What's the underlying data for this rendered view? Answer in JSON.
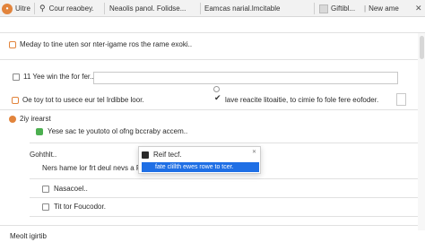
{
  "tabs": [
    {
      "label": "Uitre"
    },
    {
      "label": "Cour reaobey."
    },
    {
      "label": "Neaolis panol. Folidse..."
    },
    {
      "label": "Eamcas narial.lmcitable"
    },
    {
      "label": "Giftibl..."
    },
    {
      "label": "New ame"
    }
  ],
  "rows": {
    "r1": "Meday to tine uten sor nter-igame ros the rame exoki..",
    "r2_label": "11 Yee win the for fer..",
    "r3": "Oe toy tot to usece eur tel Irdibbe loor.",
    "r3_right": "lave reacite litoaitie, to cimie fo fole fere eofoder.",
    "section_title": "2iy irearst",
    "r4": "Yese sac te youtoto ol ofng bccraby accem..",
    "r5_title": "Gohthlt..",
    "r6": "Ners hame lor frt deul nevs a Footdbe.....",
    "r7": "Nasacoel..",
    "r8": "Tit tor Foucodor.",
    "footer": "Meolt igirtib"
  },
  "popup": {
    "item1": "Reif tecf.",
    "item2": "fate clillth ewes rowe to tcer."
  },
  "colors": {
    "accent": "#e2843c",
    "selection": "#1f6fe5",
    "green": "#4caf50"
  }
}
